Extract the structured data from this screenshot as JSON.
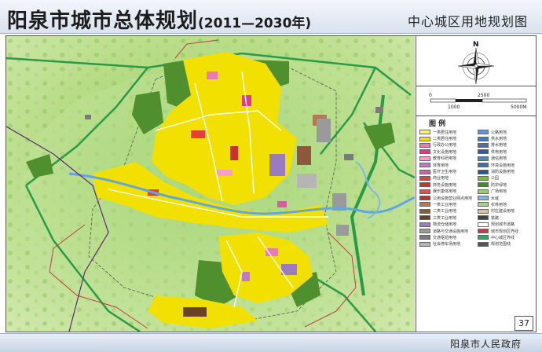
{
  "header": {
    "title": "阳泉市城市总体规划",
    "years": "(2011—2030年)",
    "subtitle": "中心城区用地规划图"
  },
  "compass": {
    "north_label": "N"
  },
  "scale_bar": {
    "ticks": [
      {
        "label": "0"
      },
      {
        "label": "1000"
      },
      {
        "label": "2500"
      },
      {
        "label": "5000M"
      }
    ]
  },
  "legend": {
    "title": "图  例",
    "items": [
      {
        "label": "一类居住用地",
        "color": "#f7f27a"
      },
      {
        "label": "公路用地",
        "color": "#5b9bd5"
      },
      {
        "label": "二类居住用地",
        "color": "#f2e000"
      },
      {
        "label": "供水用地",
        "color": "#3a7dbf"
      },
      {
        "label": "行政办公用地",
        "color": "#e87ab4"
      },
      {
        "label": "排水用地",
        "color": "#4a6fa0"
      },
      {
        "label": "文化设施用地",
        "color": "#e03a8a"
      },
      {
        "label": "供电用地",
        "color": "#2f5f9a"
      },
      {
        "label": "教育科研用地",
        "color": "#f4a0c8"
      },
      {
        "label": "通信用地",
        "color": "#4d86b8"
      },
      {
        "label": "体育用地",
        "color": "#c07ac0"
      },
      {
        "label": "环境设施用地",
        "color": "#3e6ea8"
      },
      {
        "label": "医疗卫生用地",
        "color": "#d45fa0"
      },
      {
        "label": "消防设施用地",
        "color": "#2a5590"
      },
      {
        "label": "商业用地",
        "color": "#e3403a"
      },
      {
        "label": "公园",
        "color": "#6fbf3a"
      },
      {
        "label": "商务设施用地",
        "color": "#c8322d"
      },
      {
        "label": "防护绿地",
        "color": "#3f8f2a"
      },
      {
        "label": "娱乐康体用地",
        "color": "#d9534f"
      },
      {
        "label": "广场用地",
        "color": "#9acd62"
      },
      {
        "label": "公用设施营业网点用地",
        "color": "#b83030"
      },
      {
        "label": "水域",
        "color": "#7fb7e0"
      },
      {
        "label": "一类工业用地",
        "color": "#b07a5a"
      },
      {
        "label": "农林用地",
        "color": "#a8d08a"
      },
      {
        "label": "二类工业用地",
        "color": "#8b5a3c"
      },
      {
        "label": "村庄建设用地",
        "color": "#d8c0a0"
      },
      {
        "label": "三类工业用地",
        "color": "#6b3f28"
      },
      {
        "label": "铁路",
        "color": "#444444"
      },
      {
        "label": "物流仓储用地",
        "color": "#9b7bbf"
      },
      {
        "label": "规划城市道路",
        "color": "#ffffff"
      },
      {
        "label": "道路与交通设施用地",
        "color": "#9a9a9a"
      },
      {
        "label": "城市规划区界线",
        "color": "#c04040"
      },
      {
        "label": "交通枢纽用地",
        "color": "#7a7a7a"
      },
      {
        "label": "中心城区界线",
        "color": "#3aa35a"
      },
      {
        "label": "社会停车场用地",
        "color": "#b5b5b5"
      },
      {
        "label": "规划范围线",
        "color": "#555555"
      }
    ]
  },
  "page_number": "37",
  "footer": {
    "issuer": "阳泉市人民政府"
  }
}
